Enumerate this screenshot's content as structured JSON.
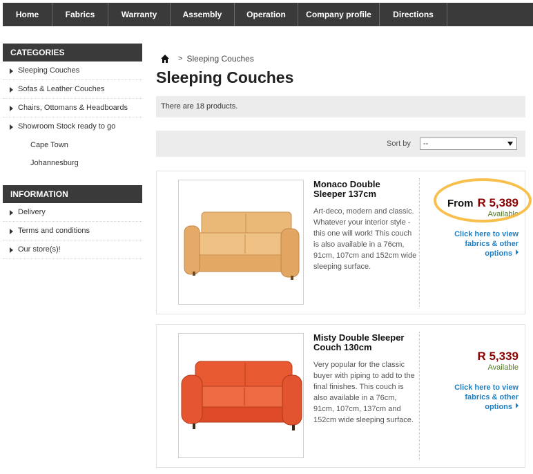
{
  "nav": [
    "Home",
    "Fabrics",
    "Warranty",
    "Assembly",
    "Operation",
    "Company profile",
    "Directions"
  ],
  "sidebar": {
    "categories_title": "CATEGORIES",
    "categories": [
      "Sleeping Couches",
      "Sofas & Leather Couches",
      "Chairs, Ottomans & Headboards",
      "Showroom Stock ready to go"
    ],
    "subcategories": [
      "Cape Town",
      "Johannesburg"
    ],
    "information_title": "INFORMATION",
    "information": [
      "Delivery",
      "Terms and conditions",
      "Our store(s)!"
    ]
  },
  "breadcrumb": {
    "sep": ">",
    "current": "Sleeping Couches"
  },
  "page_title": "Sleeping Couches",
  "count_text": "There are 18 products.",
  "sort": {
    "label": "Sort by",
    "value": "--"
  },
  "products": [
    {
      "name": "Monaco Double Sleeper 137cm",
      "desc": "Art-deco, modern and classic.  Whatever your interior style - this one will work! This couch is also available in a 76cm, 91cm, 107cm and 152cm wide sleeping surface.",
      "price_prefix": "From",
      "price": "R 5,389",
      "availability": "Available",
      "more": "Click here to view fabrics & other options",
      "color": "#e8b06e"
    },
    {
      "name": "Misty Double Sleeper Couch 130cm",
      "desc": "Very popular for the classic buyer with piping to add to the final finishes. This couch is also available in a 76cm, 91cm, 107cm, 137cm and 152cm wide sleeping surface.",
      "price_prefix": "",
      "price": "R 5,339",
      "availability": "Available",
      "more": "Click here to view fabrics & other options",
      "color": "#e8502a"
    }
  ],
  "colors": {
    "nav_bg": "#3a3a3a",
    "price": "#8b0000",
    "link": "#1d7fc4",
    "available": "#4d7a1f",
    "highlight": "#f7b83a"
  }
}
